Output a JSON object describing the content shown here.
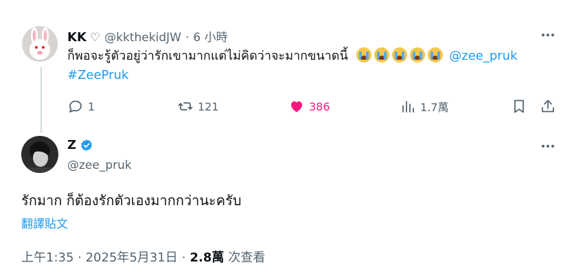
{
  "original_tweet": {
    "display_name": "KK",
    "name_suffix": "♡",
    "handle": "@kkthekidJW",
    "separator": "·",
    "time": "6 小時",
    "text_thai": "ก็พอจะรู้ตัวอยู่ว่ารักเขามากแต่ไม่คิดว่าจะมากขนาดนี้",
    "mention": "@zee_pruk",
    "hashtag": "#ZeePruk",
    "emoji_icons": [
      "loudly-crying-face-icon",
      "loudly-crying-face-icon",
      "loudly-crying-face-icon",
      "loudly-crying-face-icon",
      "loudly-crying-face-icon"
    ],
    "actions": {
      "replies": "1",
      "reposts": "121",
      "likes": "386",
      "views": "1.7萬"
    }
  },
  "reply_tweet": {
    "display_name": "Z",
    "verified": true,
    "handle": "@zee_pruk",
    "text": "รักมาก ก็ต้องรักตัวเองมากกว่านะครับ",
    "translate_label": "翻譯貼文",
    "time": "上午1:35 · 2025年5月31日",
    "separator": "·",
    "views_count": "2.8萬",
    "views_label": "次查看"
  },
  "colors": {
    "text_primary": "#0f1419",
    "text_secondary": "#536471",
    "link": "#1d9bf0",
    "like": "#f91880",
    "verified": "#1d9bf0",
    "thread_line": "#cfd9de"
  }
}
